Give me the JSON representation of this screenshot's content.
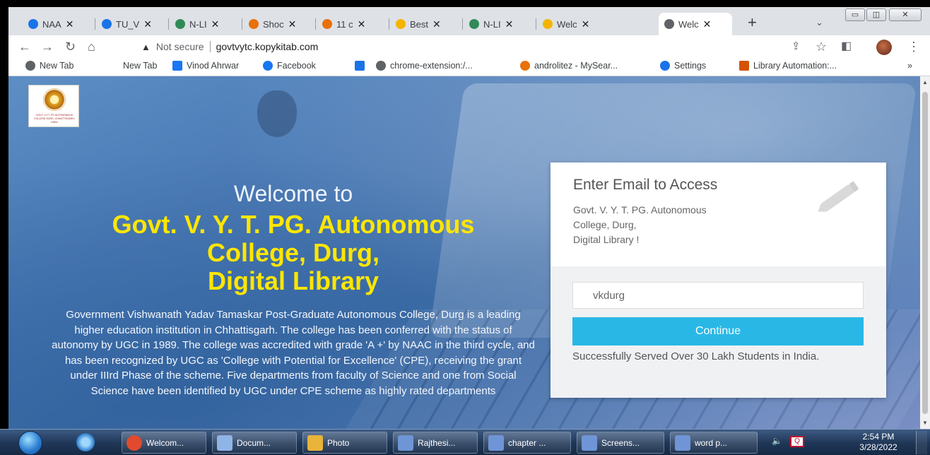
{
  "browser": {
    "tabs": [
      {
        "label": "NAA",
        "fav_color": "#1a73e8"
      },
      {
        "label": "TU_V",
        "fav_color": "#1a73e8"
      },
      {
        "label": "N-LI",
        "fav_color": "#2e8b57"
      },
      {
        "label": "Shoc",
        "fav_color": "#e8710a"
      },
      {
        "label": "11 c",
        "fav_color": "#e8710a"
      },
      {
        "label": "Best",
        "fav_color": "#f4b400"
      },
      {
        "label": "N-LI",
        "fav_color": "#2e8b57"
      },
      {
        "label": "Welc",
        "fav_color": "#f4b400"
      },
      {
        "label": "Welc",
        "fav_color": "#5f6368"
      }
    ],
    "new_tab_symbol": "+",
    "address": {
      "security": "Not secure",
      "url": "govtvytc.kopykitab.com"
    },
    "bookmarks": [
      {
        "label": "New Tab",
        "icon": "globe-icon",
        "color": "#5f6368"
      },
      {
        "label": "New Tab",
        "icon": "none",
        "color": ""
      },
      {
        "label": "Vinod Ahrwar",
        "icon": "facebook-icon",
        "color": "#1877f2"
      },
      {
        "label": "Facebook",
        "icon": "facebook-icon",
        "color": "#1877f2"
      },
      {
        "label": "",
        "icon": "search-icon",
        "color": "#1a73e8"
      },
      {
        "label": "chrome-extension:/...",
        "icon": "globe-icon",
        "color": "#5f6368"
      },
      {
        "label": "androlitez - MySear...",
        "icon": "app-icon",
        "color": "#e8710a"
      },
      {
        "label": "Settings",
        "icon": "gear-icon",
        "color": "#1a73e8"
      },
      {
        "label": "Library Automation:...",
        "icon": "library-icon",
        "color": "#d35400"
      }
    ],
    "bookmarks_overflow": "»"
  },
  "page": {
    "logo_text": "GOVT. V.Y.T. PG AUTONOMOUS COLLEGE DURG, CHHATTISGARH, INDIA",
    "welcome": "Welcome to",
    "heading_lines": [
      "Govt. V. Y. T. PG. Autonomous",
      "College, Durg,",
      "Digital Library"
    ],
    "description": "Government Vishwanath Yadav Tamaskar Post-Graduate Autonomous College, Durg is a leading higher education institution in Chhattisgarh. The college has been conferred with the status of autonomy by UGC in 1989. The college was accredited with grade 'A +' by NAAC in the third cycle, and has been recognized by UGC as 'College with Potential for Excellence' (CPE), receiving the grant under IIIrd Phase of the scheme. Five departments from faculty of Science and one from Social Science have been identified by UGC under CPE scheme as highly rated departments",
    "heading_color": "#ffe600",
    "card": {
      "title": "Enter Email to Access",
      "subtitle_lines": [
        "Govt. V. Y. T. PG. Autonomous",
        "College, Durg,",
        "Digital Library !"
      ],
      "email_value": "vkdurg",
      "continue_label": "Continue",
      "served_text": "Successfully Served Over 30 Lakh Students in India.",
      "button_color": "#29b8e6"
    }
  },
  "taskbar": {
    "buttons": [
      {
        "label": "Welcom...",
        "icon": "chrome-icon",
        "color": "#e04a2f"
      },
      {
        "label": "Docum...",
        "icon": "document-icon",
        "color": "#8fb4e6"
      },
      {
        "label": "Photo",
        "icon": "folder-icon",
        "color": "#e9b43a"
      },
      {
        "label": "Rajthesi...",
        "icon": "word-icon",
        "color": "#6f95d6"
      },
      {
        "label": "chapter ...",
        "icon": "word-icon",
        "color": "#6f95d6"
      },
      {
        "label": "Screens...",
        "icon": "word-icon",
        "color": "#6f95d6"
      },
      {
        "label": "word p...",
        "icon": "word-icon",
        "color": "#6f95d6"
      }
    ],
    "time": "2:54 PM",
    "date": "3/28/2022"
  }
}
